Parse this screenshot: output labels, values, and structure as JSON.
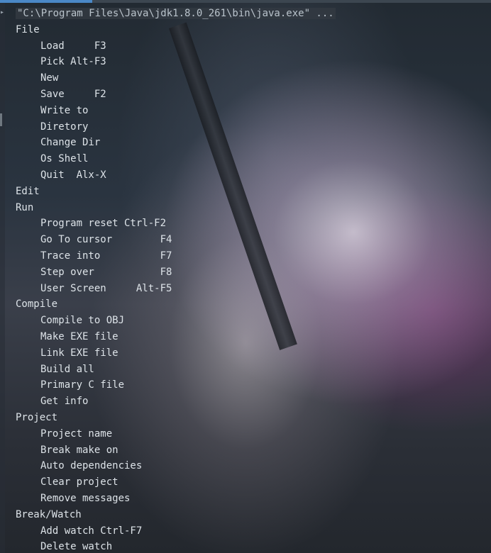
{
  "command": "\"C:\\Program Files\\Java\\jdk1.8.0_261\\bin\\java.exe\" ...",
  "lines": [
    {
      "text": "File",
      "level": 0
    },
    {
      "text": "Load     F3",
      "level": 1
    },
    {
      "text": "Pick Alt-F3",
      "level": 1
    },
    {
      "text": "New",
      "level": 1
    },
    {
      "text": "Save     F2",
      "level": 1
    },
    {
      "text": "Write to",
      "level": 1
    },
    {
      "text": "Diretory",
      "level": 1
    },
    {
      "text": "Change Dir",
      "level": 1
    },
    {
      "text": "Os Shell",
      "level": 1
    },
    {
      "text": "Quit  Alx-X",
      "level": 1
    },
    {
      "text": "Edit",
      "level": 0
    },
    {
      "text": "Run",
      "level": 0
    },
    {
      "text": "Program reset Ctrl-F2",
      "level": 1
    },
    {
      "text": "Go To cursor        F4",
      "level": 1
    },
    {
      "text": "Trace into          F7",
      "level": 1
    },
    {
      "text": "Step over           F8",
      "level": 1
    },
    {
      "text": "User Screen     Alt-F5",
      "level": 1
    },
    {
      "text": "Compile",
      "level": 0
    },
    {
      "text": "Compile to OBJ",
      "level": 1
    },
    {
      "text": "Make EXE file",
      "level": 1
    },
    {
      "text": "Link EXE file",
      "level": 1
    },
    {
      "text": "Build all",
      "level": 1
    },
    {
      "text": "Primary C file",
      "level": 1
    },
    {
      "text": "Get info",
      "level": 1
    },
    {
      "text": "Project",
      "level": 0
    },
    {
      "text": "Project name",
      "level": 1
    },
    {
      "text": "Break make on",
      "level": 1
    },
    {
      "text": "Auto dependencies",
      "level": 1
    },
    {
      "text": "Clear project",
      "level": 1
    },
    {
      "text": "Remove messages",
      "level": 1
    },
    {
      "text": "Break/Watch",
      "level": 0
    },
    {
      "text": "Add watch Ctrl-F7",
      "level": 1
    },
    {
      "text": "Delete watch",
      "level": 1
    }
  ]
}
